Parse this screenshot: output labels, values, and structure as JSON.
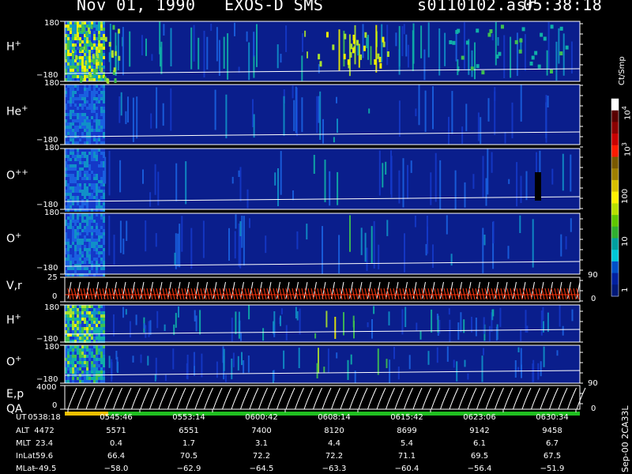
{
  "header": {
    "date": "Nov 01, 1990",
    "instrument": "EXOS-D SMS",
    "file": "s0110102.asr",
    "time": "05:38:18"
  },
  "panels": [
    {
      "id": "h_plus_1",
      "label": "H",
      "sup": "+",
      "ytop": "180",
      "ybot": "−180"
    },
    {
      "id": "he_plus",
      "label": "He",
      "sup": "+",
      "ytop": "180",
      "ybot": "−180"
    },
    {
      "id": "o_pp",
      "label": "O",
      "sup": "++",
      "ytop": "180",
      "ybot": "−180"
    },
    {
      "id": "o_plus_1",
      "label": "O",
      "sup": "+",
      "ytop": "180",
      "ybot": "−180"
    },
    {
      "id": "vr",
      "label": "V,r",
      "sup": "",
      "ytop": "25",
      "ybot": "0",
      "right_top": "90",
      "right_bot": "0"
    },
    {
      "id": "h_plus_2",
      "label": "H",
      "sup": "+",
      "ytop": "180",
      "ybot": "−180"
    },
    {
      "id": "o_plus_2",
      "label": "O",
      "sup": "+",
      "ytop": "180",
      "ybot": "−180"
    },
    {
      "id": "ep",
      "label": "E,p",
      "sup": "",
      "ytop": "4000",
      "ybot": "0",
      "right_top": "90",
      "right_bot": "0"
    }
  ],
  "qa_label": "QA",
  "colorbar": {
    "unit": "Ct/Smp",
    "labels": [
      {
        "base": "10",
        "sup": "4"
      },
      {
        "base": "10",
        "sup": "3"
      },
      {
        "base": "100",
        "sup": ""
      },
      {
        "base": "10",
        "sup": ""
      },
      {
        "base": "1",
        "sup": ""
      }
    ],
    "colors": [
      "#ffffff",
      "#5a0000",
      "#8b0000",
      "#c80000",
      "#ff1a00",
      "#7a5a00",
      "#a08000",
      "#d8c000",
      "#fff000",
      "#b8e000",
      "#60c800",
      "#30b030",
      "#00a0a0",
      "#00c8d8",
      "#0050c8",
      "#0020a0",
      "#001878"
    ]
  },
  "footer_code": "Sep-00  2CA33L",
  "table": {
    "rows": [
      {
        "label": "UT",
        "values": [
          "0538:18",
          "0545:46",
          "0553:14",
          "0600:42",
          "0608:14",
          "0615:42",
          "0623:06",
          "0630:34"
        ]
      },
      {
        "label": "ALT",
        "values": [
          "4472",
          "5571",
          "6551",
          "7400",
          "8120",
          "8699",
          "9142",
          "9458"
        ]
      },
      {
        "label": "MLT",
        "values": [
          "23.4",
          "0.4",
          "1.7",
          "3.1",
          "4.4",
          "5.4",
          "6.1",
          "6.7"
        ]
      },
      {
        "label": "InLat",
        "values": [
          "59.6",
          "66.4",
          "70.5",
          "72.2",
          "72.2",
          "71.1",
          "69.5",
          "67.5"
        ]
      },
      {
        "label": "MLat",
        "values": [
          "−49.5",
          "−58.0",
          "−62.9",
          "−64.5",
          "−63.3",
          "−60.4",
          "−56.4",
          "−51.9"
        ]
      }
    ]
  },
  "chart_data": {
    "type": "heatmap",
    "x_ticks_ut": [
      "0538:18",
      "0545:46",
      "0553:14",
      "0600:42",
      "0608:14",
      "0615:42",
      "0623:06",
      "0630:34"
    ],
    "pitch_angle_range": [
      -180,
      180
    ],
    "vr_range": [
      0,
      25
    ],
    "ep_range": [
      0,
      4000
    ],
    "right_axis_range": [
      0,
      90
    ],
    "color_scale": "log",
    "color_range": [
      1,
      10000
    ]
  }
}
